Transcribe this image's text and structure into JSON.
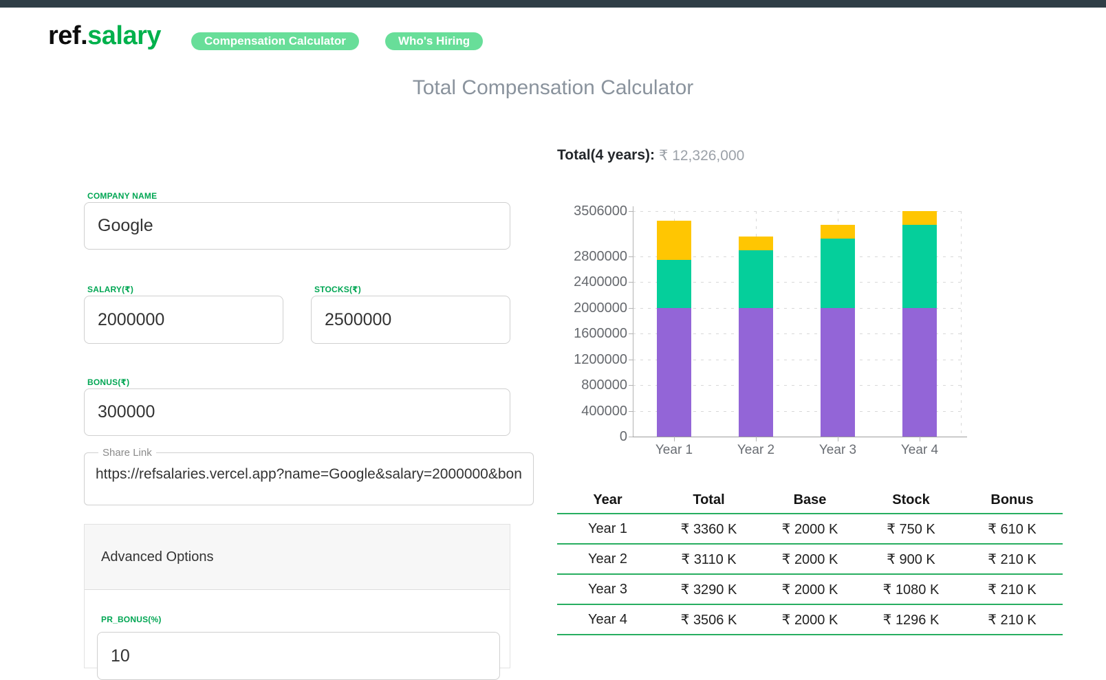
{
  "header": {
    "logo_prefix": "ref.",
    "logo_suffix": "salary",
    "nav": [
      {
        "label": "Compensation Calculator"
      },
      {
        "label": "Who's Hiring"
      }
    ]
  },
  "page_title": "Total Compensation Calculator",
  "form": {
    "company": {
      "label": "COMPANY NAME",
      "value": "Google"
    },
    "salary": {
      "label": "SALARY(₹)",
      "value": "2000000"
    },
    "stocks": {
      "label": "STOCKS(₹)",
      "value": "2500000"
    },
    "bonus": {
      "label": "BONUS(₹)",
      "value": "300000"
    },
    "share_link": {
      "label": "Share Link",
      "value": "https://refsalaries.vercel.app?name=Google&salary=2000000&bon"
    },
    "advanced": {
      "title": "Advanced Options",
      "pr_bonus": {
        "label": "PR_BONUS(%)",
        "value": "10"
      }
    }
  },
  "summary": {
    "label": "Total(4 years):",
    "value": "₹ 12,326,000"
  },
  "chart_data": {
    "type": "bar",
    "stacked": true,
    "title": "",
    "xlabel": "",
    "ylabel": "",
    "categories": [
      "Year 1",
      "Year 2",
      "Year 3",
      "Year 4"
    ],
    "series": [
      {
        "name": "Base",
        "color": "#9365D7",
        "values": [
          2000000,
          2000000,
          2000000,
          2000000
        ]
      },
      {
        "name": "Stock",
        "color": "#05CF9B",
        "values": [
          750000,
          900000,
          1080000,
          1296000
        ]
      },
      {
        "name": "Bonus",
        "color": "#FFC602",
        "values": [
          610000,
          210000,
          210000,
          210000
        ]
      }
    ],
    "totals": [
      3360000,
      3110000,
      3290000,
      3506000
    ],
    "yticks": [
      0,
      400000,
      800000,
      1200000,
      1600000,
      2000000,
      2400000,
      2800000,
      3506000
    ],
    "ylim": [
      0,
      3506000
    ],
    "grid": "dashed",
    "legend": "none"
  },
  "table": {
    "headers": [
      "Year",
      "Total",
      "Base",
      "Stock",
      "Bonus"
    ],
    "rows": [
      [
        "Year 1",
        "₹ 3360 K",
        "₹ 2000 K",
        "₹ 750 K",
        "₹ 610 K"
      ],
      [
        "Year 2",
        "₹ 3110 K",
        "₹ 2000 K",
        "₹ 900 K",
        "₹ 210 K"
      ],
      [
        "Year 3",
        "₹ 3290 K",
        "₹ 2000 K",
        "₹ 1080 K",
        "₹ 210 K"
      ],
      [
        "Year 4",
        "₹ 3506 K",
        "₹ 2000 K",
        "₹ 1296 K",
        "₹ 210 K"
      ]
    ]
  },
  "colors": {
    "topbar": "#2F3E46",
    "brand_green": "#00B14C",
    "badge_green": "#68DE99",
    "label_green": "#00A653",
    "table_line_green": "#27AE60",
    "bar_purple": "#9365D7",
    "bar_green": "#05CF9B",
    "bar_yellow": "#FFC602"
  }
}
